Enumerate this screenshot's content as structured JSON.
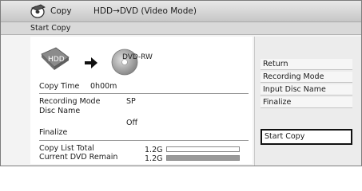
{
  "header": {
    "icon": "dvd-recorder-icon",
    "title": "Copy",
    "mode": "HDD→DVD (Video Mode)"
  },
  "subheader": {
    "title": "Start Copy"
  },
  "transfer": {
    "source": "HDD",
    "destination": "DVD-RW",
    "arrow_icon": "arrow-right-icon"
  },
  "info": {
    "copy_time_label": "Copy Time",
    "copy_time_value": "0h00m",
    "recording_mode_label": "Recording Mode",
    "recording_mode_value": "SP",
    "disc_name_label": "Disc Name",
    "disc_name_value": "",
    "finalize_value": "Off",
    "finalize_label": "Finalize"
  },
  "capacity": {
    "copy_list_total_label": "Copy List Total",
    "copy_list_total_value": "1.2G",
    "copy_list_total_fill": 0.0,
    "current_dvd_remain_label": "Current DVD Remain",
    "current_dvd_remain_value": "1.2G",
    "current_dvd_remain_fill": 1.0
  },
  "menu": {
    "items": [
      "Return",
      "Recording Mode",
      "Input Disc Name",
      "Finalize"
    ],
    "selected": "Start Copy"
  },
  "colors": {
    "selected_border": "#111111",
    "bar_fill": "#9a9a9a"
  }
}
